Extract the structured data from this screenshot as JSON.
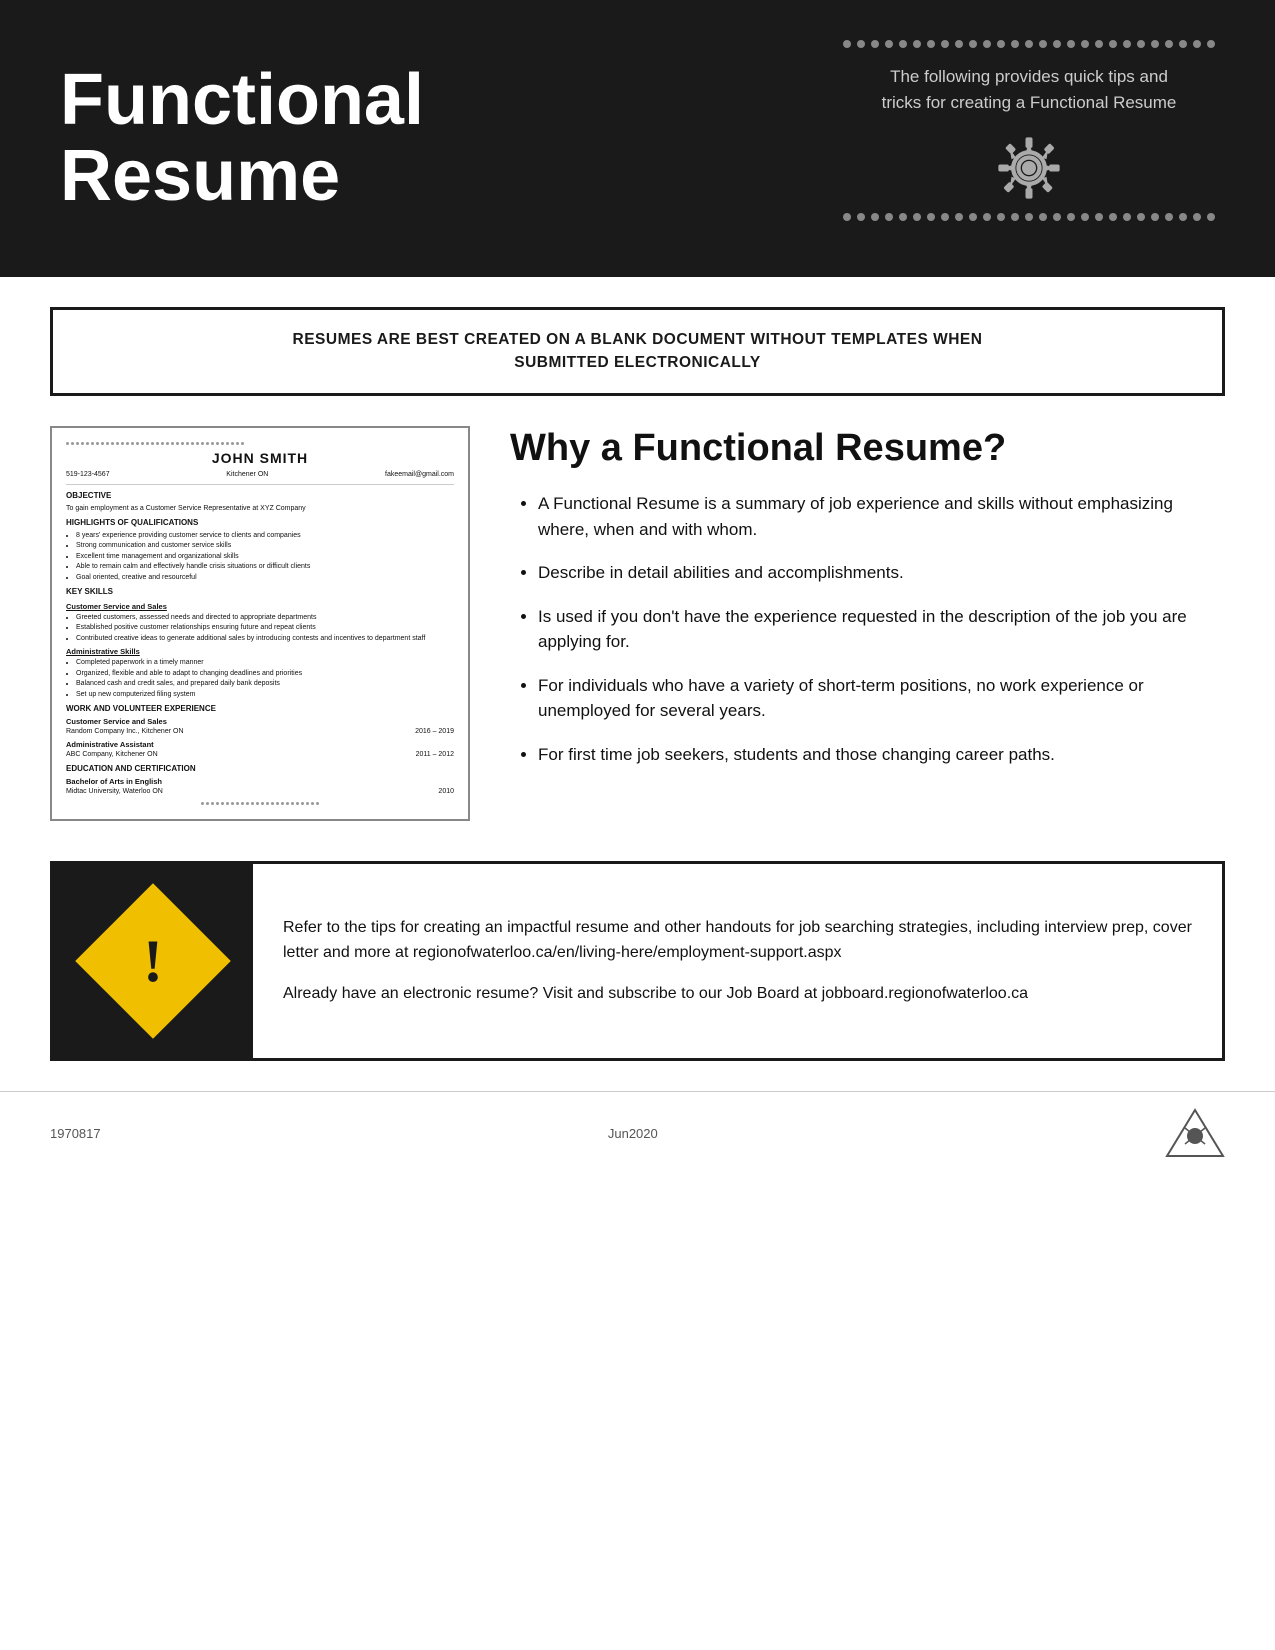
{
  "header": {
    "title_line1": "Functional",
    "title_line2": "Resume",
    "tagline_line1": "The following provides quick tips and",
    "tagline_line2": "tricks for creating a Functional Resume"
  },
  "banner": {
    "text_line1": "RESUMES ARE BEST CREATED ON A BLANK DOCUMENT WITHOUT TEMPLATES WHEN",
    "text_line2": "SUBMITTED ELECTRONICALLY"
  },
  "resume_preview": {
    "name": "JOHN SMITH",
    "phone": "519-123-4567",
    "location": "Kitchener ON",
    "email": "fakeemail@gmail.com",
    "objective_title": "OBJECTIVE",
    "objective_text": "To gain employment as a Customer Service Representative at XYZ Company",
    "highlights_title": "HIGHLIGHTS OF QUALIFICATIONS",
    "highlights": [
      "8 years' experience providing customer service to clients and companies",
      "Strong communication and customer service skills",
      "Excellent time management and organizational skills",
      "Able to remain calm and effectively handle crisis situations or difficult clients",
      "Goal oriented, creative and resourceful"
    ],
    "key_skills_title": "KEY SKILLS",
    "cs_title": "Customer Service and Sales",
    "cs_bullets": [
      "Greeted customers, assessed needs and directed to appropriate departments",
      "Established positive customer relationships ensuring future and repeat clients",
      "Contributed creative ideas to generate additional sales by introducing contests and incentives to department staff"
    ],
    "admin_title": "Administrative Skills",
    "admin_bullets": [
      "Completed paperwork in a timely manner",
      "Organized, flexible and able to adapt to changing deadlines and priorities",
      "Balanced cash and credit sales, and prepared daily bank deposits",
      "Set up new computerized filing system"
    ],
    "work_title": "WORK AND VOLUNTEER EXPERIENCE",
    "work_items": [
      {
        "title": "Customer Service and Sales",
        "company": "Random Company Inc., Kitchener ON",
        "dates": "2016 – 2019"
      },
      {
        "title": "Administrative Assistant",
        "company": "ABC Company, Kitchener ON",
        "dates": "2011 – 2012"
      }
    ],
    "edu_title": "EDUCATION AND CERTIFICATION",
    "edu_items": [
      {
        "degree": "Bachelor of Arts in English",
        "school": "Midtac University, Waterloo ON",
        "year": "2010"
      }
    ]
  },
  "why_section": {
    "title": "Why a Functional Resume?",
    "bullets": [
      "A Functional Resume is a summary of job experience and skills without emphasizing where, when and with whom.",
      "Describe in detail abilities and accomplishments.",
      "Is used if you don't have the experience requested in the description of the job you are applying for.",
      "For individuals who have a variety of short-term positions, no work experience or unemployed for several years.",
      "For first time job seekers, students and those changing career paths."
    ]
  },
  "warning_section": {
    "para1": "Refer to the tips for creating an impactful resume and other handouts for job searching strategies, including interview prep, cover letter and more at regionofwaterloo.ca/en/living-here/employment-support.aspx",
    "para2": "Already have an electronic resume? Visit and subscribe to our Job Board at jobboard.regionofwaterloo.ca"
  },
  "footer": {
    "code": "1970817",
    "date": "Jun2020"
  }
}
